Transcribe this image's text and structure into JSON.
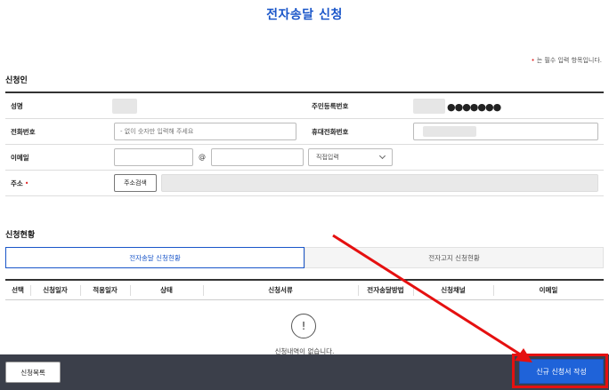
{
  "page": {
    "title": "전자송달 신청",
    "required_note_marker": "•",
    "required_note": "는 필수 입력 항목입니다."
  },
  "applicant": {
    "section_title": "신청인",
    "name_label": "성명",
    "rrn_label": "주민등록번호",
    "rrn_masked": "●●●●●●●",
    "phone_label": "전화번호",
    "phone_placeholder": "- 없이 숫자만 입력해 주세요",
    "mobile_label": "휴대전화번호",
    "email_label": "이메일",
    "email_at": "@",
    "email_domain_select": "직접입력",
    "address_label": "주소",
    "address_required_marker": "•",
    "address_search_button": "주소검색"
  },
  "status": {
    "section_title": "신청현황",
    "tabs": [
      {
        "label": "전자송달 신청현황",
        "active": true
      },
      {
        "label": "전자고지 신청현황",
        "active": false
      }
    ],
    "columns": [
      "선택",
      "신청일자",
      "적용일자",
      "상태",
      "신청서류",
      "전자송달방법",
      "신청채널",
      "이메일"
    ],
    "empty_icon": "!",
    "empty_message": "신청내역이 없습니다."
  },
  "footer": {
    "list_button": "신청목록",
    "new_button": "신규 신청서 작성"
  },
  "annotation": {
    "highlight_color": "#e51010",
    "accent_color": "#1f63d9"
  }
}
